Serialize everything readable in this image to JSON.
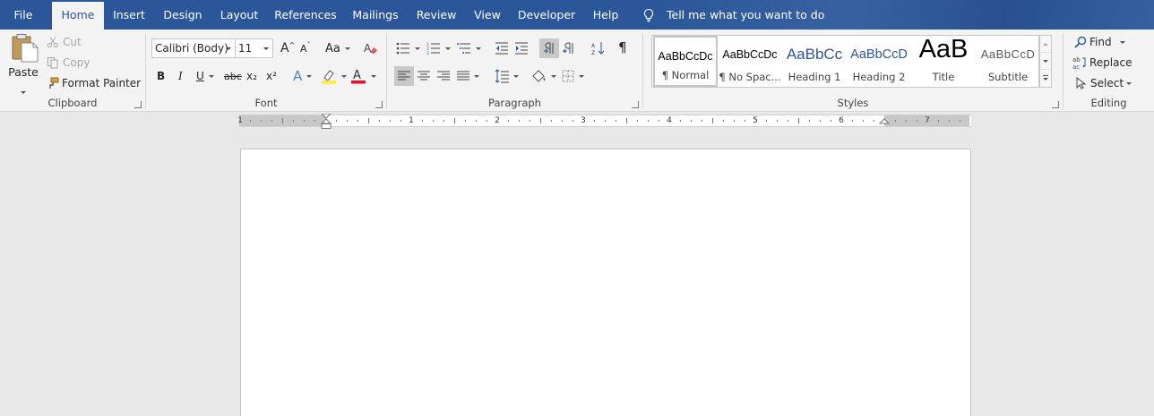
{
  "tabs": [
    {
      "label": "File"
    },
    {
      "label": "Home"
    },
    {
      "label": "Insert"
    },
    {
      "label": "Design"
    },
    {
      "label": "Layout"
    },
    {
      "label": "References"
    },
    {
      "label": "Mailings"
    },
    {
      "label": "Review"
    },
    {
      "label": "View"
    },
    {
      "label": "Developer"
    },
    {
      "label": "Help"
    }
  ],
  "active_tab": "Home",
  "tell_me": {
    "label": "Tell me what you want to do"
  },
  "clipboard": {
    "paste": "Paste",
    "cut": "Cut",
    "copy": "Copy",
    "format_painter": "Format Painter",
    "label": "Clipboard"
  },
  "font": {
    "family": "Calibri (Body)",
    "size": "11",
    "label": "Font",
    "bold": "B",
    "italic": "I",
    "underline": "U",
    "strikethrough": "abc",
    "subscript": "x₂",
    "superscript": "x²",
    "grow": "A",
    "shrink": "A",
    "change_case": "Aa",
    "font_color": "A",
    "text_effects": "A"
  },
  "paragraph": {
    "label": "Paragraph",
    "pilcrow": "¶"
  },
  "styles": {
    "label": "Styles",
    "items": [
      {
        "preview": "AaBbCcDc",
        "name": "¶ Normal"
      },
      {
        "preview": "AaBbCcDc",
        "name": "¶ No Spac..."
      },
      {
        "preview": "AaBbCc",
        "name": "Heading 1"
      },
      {
        "preview": "AaBbCcD",
        "name": "Heading 2"
      },
      {
        "preview": "AaB",
        "name": "Title"
      },
      {
        "preview": "AaBbCcD",
        "name": "Subtitle"
      }
    ]
  },
  "editing": {
    "find": "Find",
    "replace": "Replace",
    "select": "Select",
    "replace_icon_text": "ab\nac",
    "label": "Editing"
  },
  "ruler": {
    "numbers": [
      "1",
      "1",
      "2",
      "3",
      "4",
      "5",
      "6",
      "7"
    ]
  },
  "colors": {
    "title_bar": "#2b579a",
    "ribbon": "#f3f3f3",
    "workspace": "#e8e8e8",
    "font_color_red": "#e81123",
    "highlight_yellow": "#ffeb3b",
    "heading_blue": "#2f5496"
  }
}
